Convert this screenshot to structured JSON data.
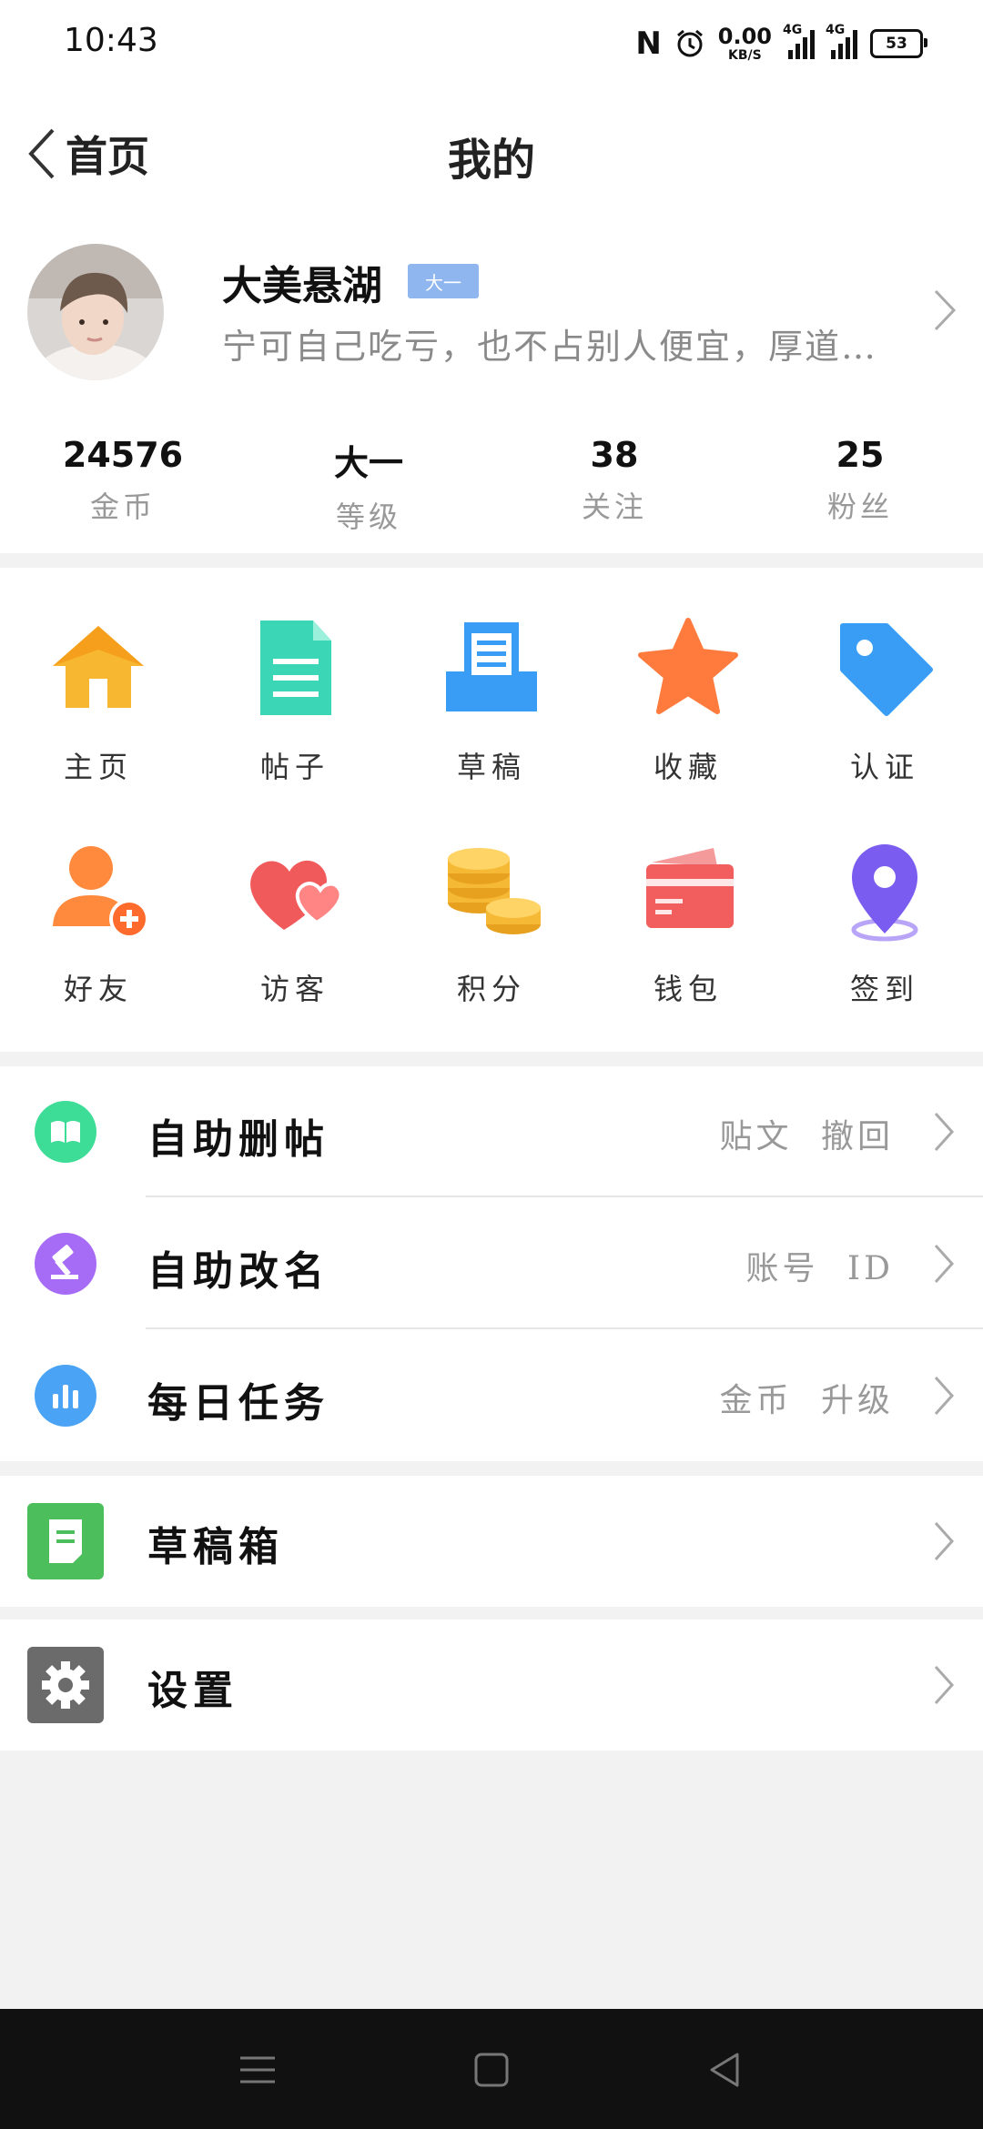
{
  "status_bar": {
    "time": "10:43",
    "speed_value": "0.00",
    "speed_unit": "KB/S",
    "sim1": "4G",
    "sim2": "4G",
    "battery": "53"
  },
  "header": {
    "back_label": "首页",
    "title": "我的"
  },
  "profile": {
    "username": "大美悬湖",
    "level_badge": "大一",
    "bio": "宁可自己吃亏，也不占别人便宜，厚道…"
  },
  "stats": [
    {
      "value": "24576",
      "label": "金币"
    },
    {
      "value": "大一",
      "label": "等级"
    },
    {
      "value": "38",
      "label": "关注"
    },
    {
      "value": "25",
      "label": "粉丝"
    }
  ],
  "grid": [
    {
      "label": "主页",
      "icon": "home-icon",
      "color": "#f7b731"
    },
    {
      "label": "帖子",
      "icon": "document-icon",
      "color": "#3ad6b6"
    },
    {
      "label": "草稿",
      "icon": "draft-tray-icon",
      "color": "#3a9df5"
    },
    {
      "label": "收藏",
      "icon": "star-icon",
      "color": "#ff7a3d"
    },
    {
      "label": "认证",
      "icon": "tag-icon",
      "color": "#3a9df5"
    },
    {
      "label": "好友",
      "icon": "add-friend-icon",
      "color": "#ff8a3d"
    },
    {
      "label": "访客",
      "icon": "visitor-hearts-icon",
      "color": "#f05a5a"
    },
    {
      "label": "积分",
      "icon": "coins-icon",
      "color": "#f6b936"
    },
    {
      "label": "钱包",
      "icon": "wallet-icon",
      "color": "#f25d5d"
    },
    {
      "label": "签到",
      "icon": "location-pin-icon",
      "color": "#7b5cf0"
    }
  ],
  "list": [
    {
      "title": "自助删帖",
      "sub": "贴文 撤回",
      "icon": "book-icon",
      "color": "#3ddc97"
    },
    {
      "title": "自助改名",
      "sub": "账号 ID",
      "icon": "gavel-icon",
      "color": "#a66cf5"
    },
    {
      "title": "每日任务",
      "sub": "金币 升级",
      "icon": "bar-chart-icon",
      "color": "#4aa3f5"
    }
  ],
  "drafts": {
    "title": "草稿箱",
    "icon": "note-icon",
    "color": "#4cbf5c"
  },
  "settings": {
    "title": "设置",
    "icon": "gear-icon",
    "color": "#6b6b6b"
  }
}
